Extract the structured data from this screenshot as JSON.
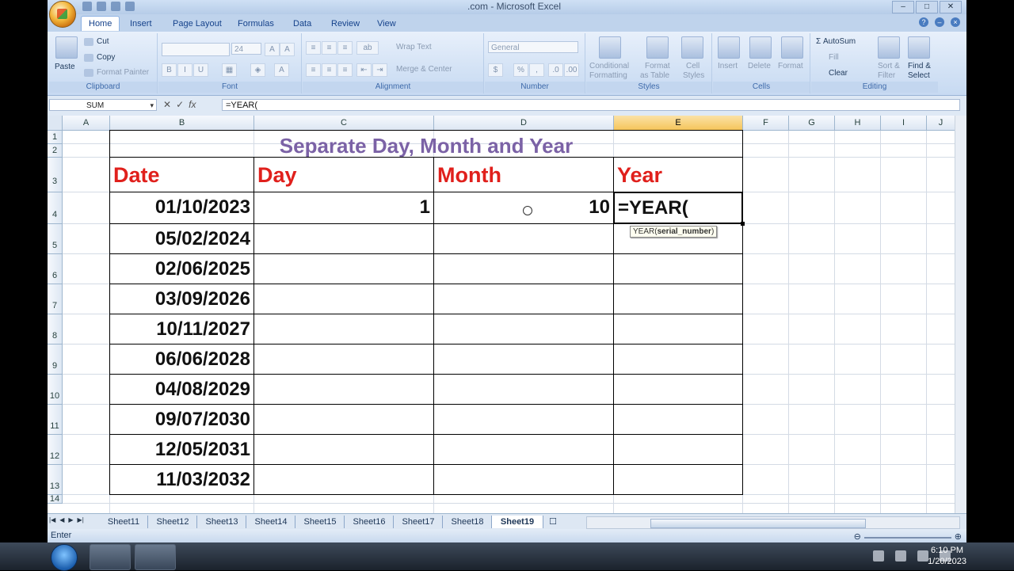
{
  "window": {
    "title": ".com - Microsoft Excel",
    "controls": [
      "–",
      "□",
      "✕"
    ]
  },
  "ribbon_tabs": [
    "Home",
    "Insert",
    "Page Layout",
    "Formulas",
    "Data",
    "Review",
    "View"
  ],
  "ribbon": {
    "clipboard": {
      "paste": "Paste",
      "cut": "Cut",
      "copy": "Copy",
      "format_painter": "Format Painter",
      "name": "Clipboard"
    },
    "font": {
      "size": "24",
      "name": "Font"
    },
    "alignment": {
      "wrap": "Wrap Text",
      "merge": "Merge & Center",
      "name": "Alignment"
    },
    "number": {
      "format": "General",
      "currency": "$",
      "percent": "%",
      "comma": ",",
      "name": "Number"
    },
    "styles": {
      "conditional": "Conditional",
      "conditional2": "Formatting",
      "format_as": "Format",
      "format_as2": "as Table",
      "cell": "Cell",
      "cell2": "Styles",
      "name": "Styles"
    },
    "cells": {
      "insert": "Insert",
      "delete": "Delete",
      "format": "Format",
      "name": "Cells"
    },
    "editing": {
      "autosum": "AutoSum",
      "fill": "Fill",
      "clear": "Clear",
      "sort": "Sort &",
      "sort2": "Filter",
      "find": "Find &",
      "find2": "Select",
      "name": "Editing"
    }
  },
  "formula_bar": {
    "name_box": "SUM",
    "formula": "=YEAR("
  },
  "columns": [
    "A",
    "B",
    "C",
    "D",
    "E",
    "F",
    "G",
    "H",
    "I",
    "J"
  ],
  "rows": [
    "1",
    "2",
    "3",
    "4",
    "5",
    "6",
    "7",
    "8",
    "9",
    "10",
    "11",
    "12",
    "13",
    "14"
  ],
  "sheet": {
    "title": "Separate Day, Month and Year",
    "headers": {
      "date": "Date",
      "day": "Day",
      "month": "Month",
      "year": "Year"
    },
    "dates": [
      "01/10/2023",
      "05/02/2024",
      "02/06/2025",
      "03/09/2026",
      "10/11/2027",
      "06/06/2028",
      "04/08/2029",
      "09/07/2030",
      "12/05/2031",
      "11/03/2032"
    ],
    "day_row4": "1",
    "month_row4": "10",
    "year_row4_editing": "=YEAR(",
    "tooltip": {
      "fn": "YEAR(",
      "arg": "serial_number",
      "close": ")"
    }
  },
  "sheet_tabs": [
    "Sheet11",
    "Sheet12",
    "Sheet13",
    "Sheet14",
    "Sheet15",
    "Sheet16",
    "Sheet17",
    "Sheet18",
    "Sheet19"
  ],
  "active_sheet": "Sheet19",
  "status": {
    "mode": "Enter"
  },
  "taskbar": {
    "time": "6:10 PM",
    "date": "1/20/2023"
  }
}
